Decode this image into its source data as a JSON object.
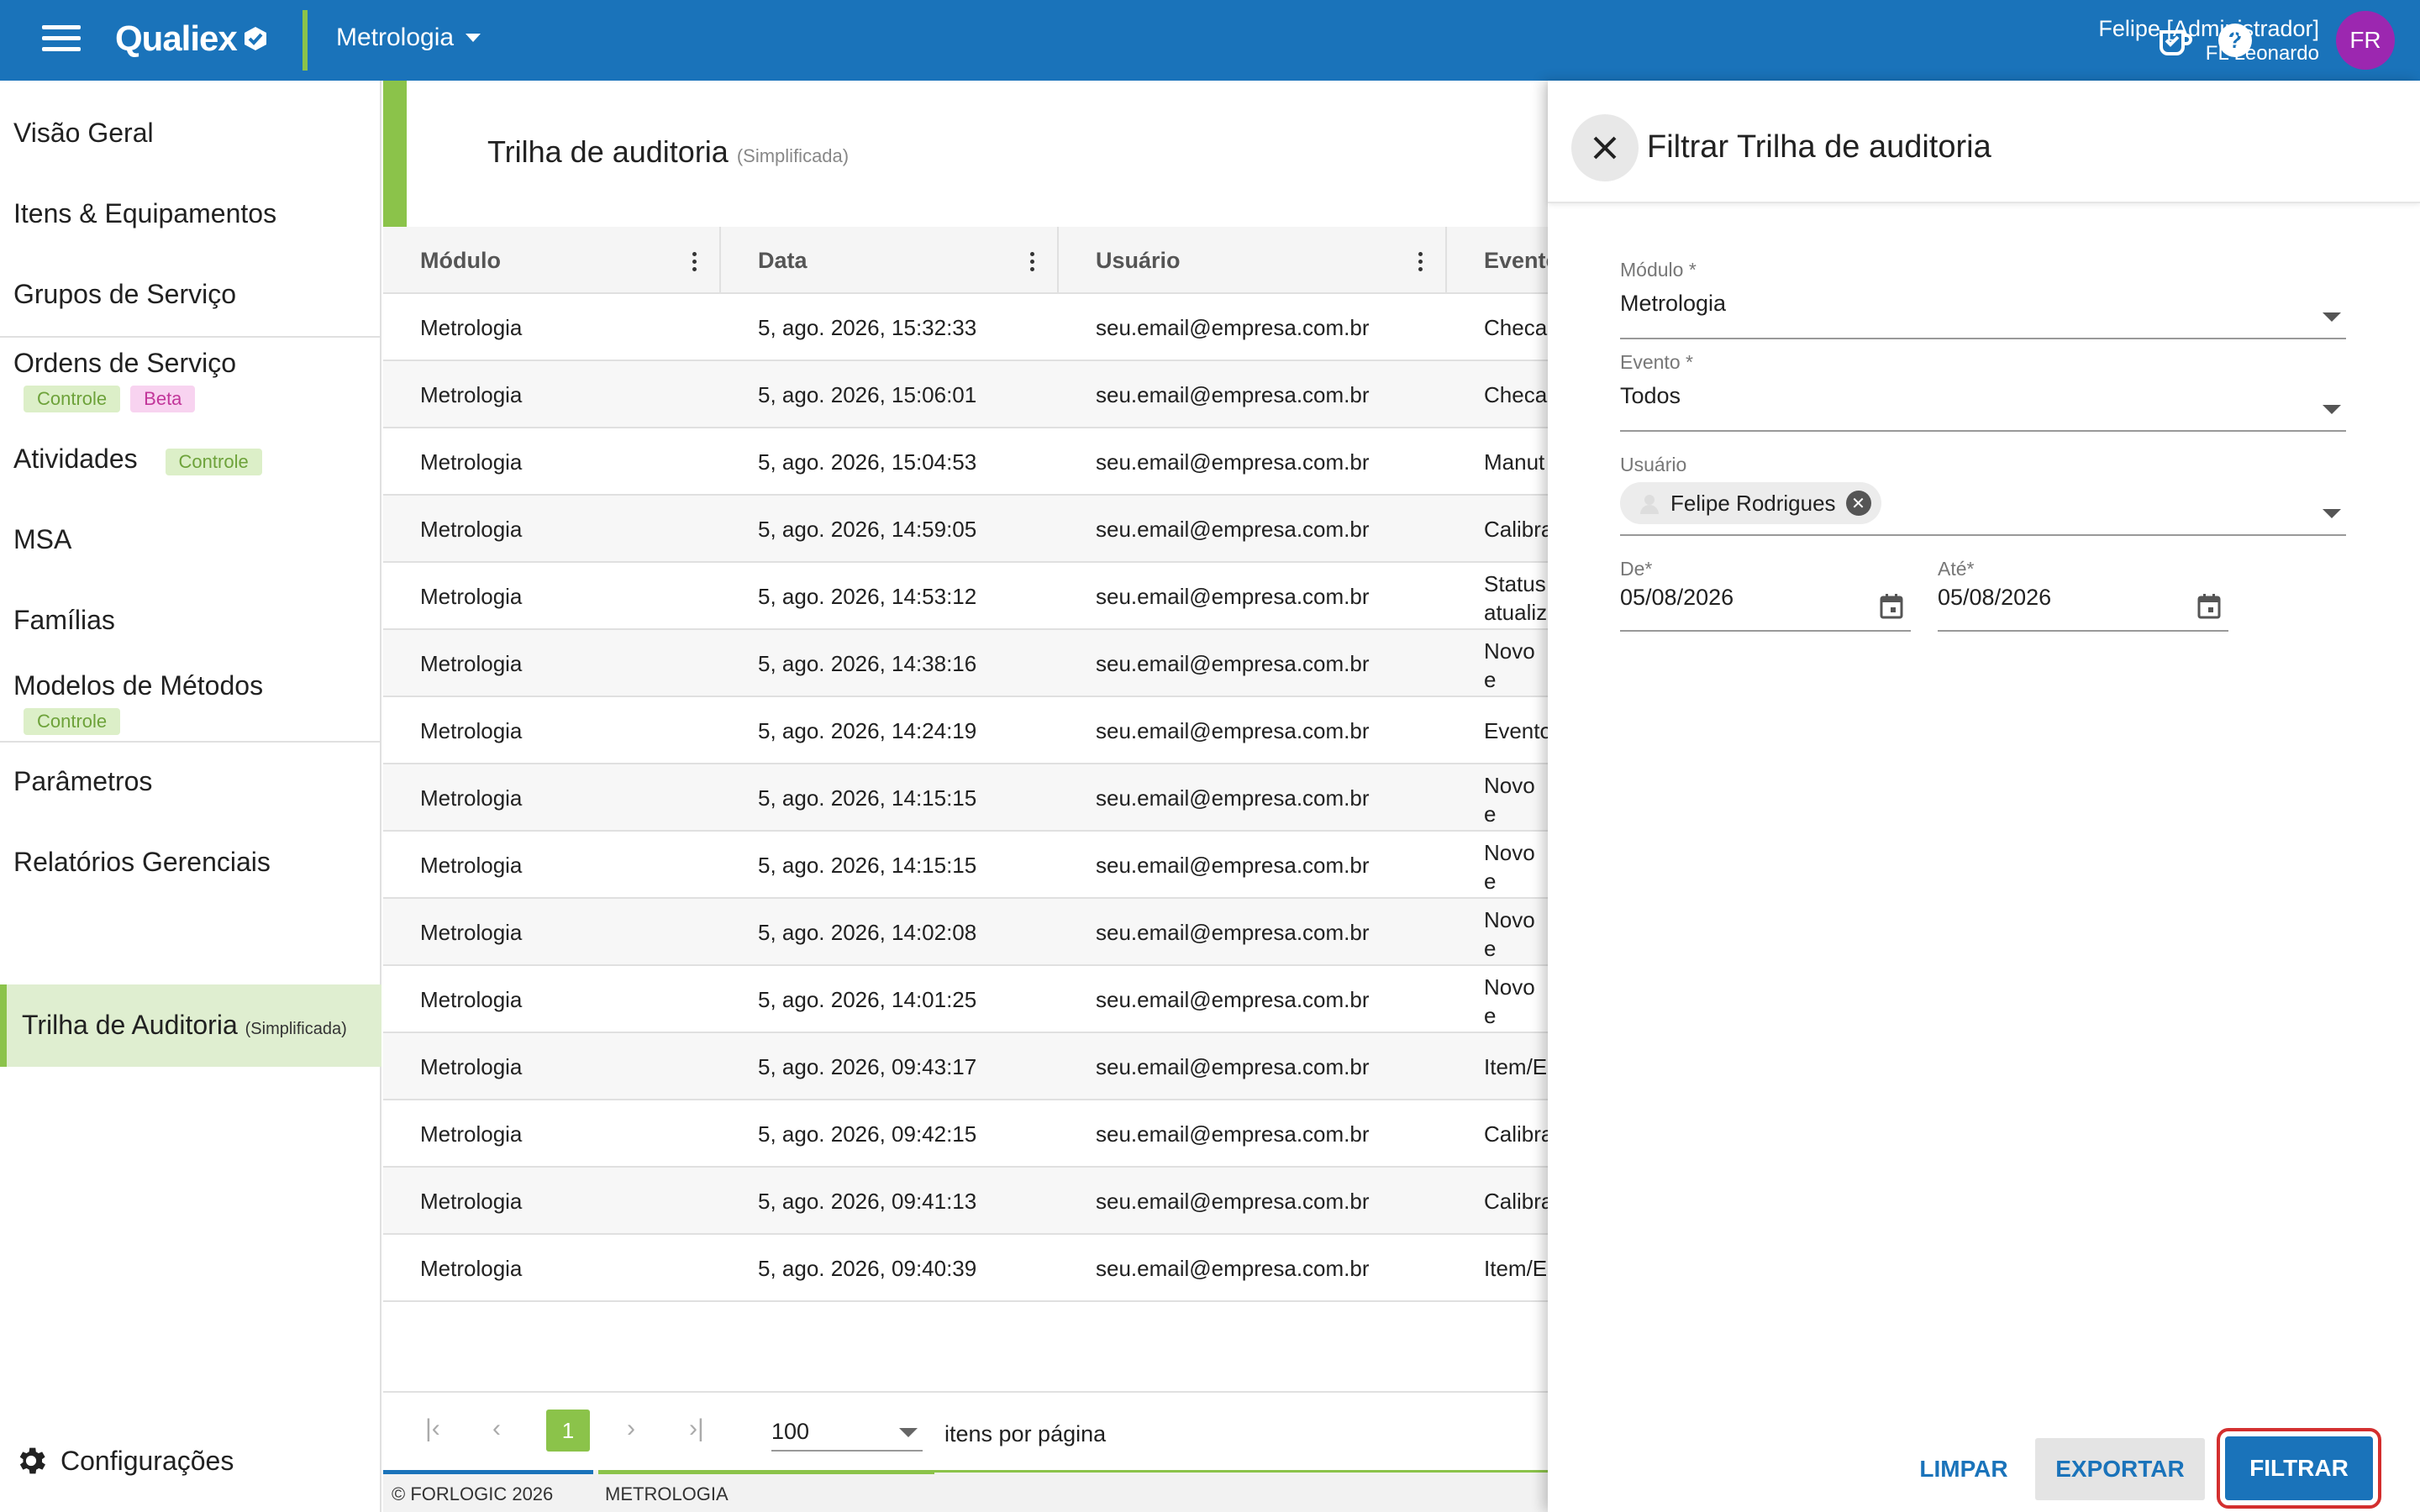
{
  "header": {
    "app_name": "Qualiex",
    "module": "Metrologia",
    "user_name": "Felipe [Administrador]",
    "user_org": "FL Leonardo",
    "avatar_initials": "FR",
    "brand_color": "#1a73ba",
    "accent_color": "#8bc34a"
  },
  "sidebar": {
    "items": [
      {
        "label": "Visão Geral"
      },
      {
        "label": "Itens & Equipamentos"
      },
      {
        "label": "Grupos de Serviço"
      },
      {
        "label": "Ordens de Serviço",
        "badges": [
          "Controle",
          "Beta"
        ]
      },
      {
        "label": "Atividades",
        "badges": [
          "Controle"
        ]
      },
      {
        "label": "MSA"
      },
      {
        "label": "Famílias"
      },
      {
        "label": "Modelos de Métodos",
        "badges": [
          "Controle"
        ]
      },
      {
        "label": "Parâmetros"
      },
      {
        "label": "Relatórios Gerenciais"
      },
      {
        "label": "Trilha de Auditoria",
        "suffix": "(Simplificada)"
      }
    ],
    "settings_label": "Configurações"
  },
  "main": {
    "title": "Trilha de auditoria",
    "title_suffix": "(Simplificada)",
    "columns": [
      "Módulo",
      "Data",
      "Usuário",
      "Evento"
    ],
    "rows": [
      {
        "modulo": "Metrologia",
        "data": "5, ago. 2026, 15:32:33",
        "usuario": "seu.email@empresa.com.br",
        "evento": "Checag"
      },
      {
        "modulo": "Metrologia",
        "data": "5, ago. 2026, 15:06:01",
        "usuario": "seu.email@empresa.com.br",
        "evento": "Checag"
      },
      {
        "modulo": "Metrologia",
        "data": "5, ago. 2026, 15:04:53",
        "usuario": "seu.email@empresa.com.br",
        "evento": "Manut"
      },
      {
        "modulo": "Metrologia",
        "data": "5, ago. 2026, 14:59:05",
        "usuario": "seu.email@empresa.com.br",
        "evento": "Calibra"
      },
      {
        "modulo": "Metrologia",
        "data": "5, ago. 2026, 14:53:12",
        "usuario": "seu.email@empresa.com.br",
        "evento": "Status atualiz"
      },
      {
        "modulo": "Metrologia",
        "data": "5, ago. 2026, 14:38:16",
        "usuario": "seu.email@empresa.com.br",
        "evento": "Novo e"
      },
      {
        "modulo": "Metrologia",
        "data": "5, ago. 2026, 14:24:19",
        "usuario": "seu.email@empresa.com.br",
        "evento": "Evento"
      },
      {
        "modulo": "Metrologia",
        "data": "5, ago. 2026, 14:15:15",
        "usuario": "seu.email@empresa.com.br",
        "evento": "Novo e"
      },
      {
        "modulo": "Metrologia",
        "data": "5, ago. 2026, 14:15:15",
        "usuario": "seu.email@empresa.com.br",
        "evento": "Novo e"
      },
      {
        "modulo": "Metrologia",
        "data": "5, ago. 2026, 14:02:08",
        "usuario": "seu.email@empresa.com.br",
        "evento": "Novo e"
      },
      {
        "modulo": "Metrologia",
        "data": "5, ago. 2026, 14:01:25",
        "usuario": "seu.email@empresa.com.br",
        "evento": "Novo e"
      },
      {
        "modulo": "Metrologia",
        "data": "5, ago. 2026, 09:43:17",
        "usuario": "seu.email@empresa.com.br",
        "evento": "Item/E"
      },
      {
        "modulo": "Metrologia",
        "data": "5, ago. 2026, 09:42:15",
        "usuario": "seu.email@empresa.com.br",
        "evento": "Calibra"
      },
      {
        "modulo": "Metrologia",
        "data": "5, ago. 2026, 09:41:13",
        "usuario": "seu.email@empresa.com.br",
        "evento": "Calibra"
      },
      {
        "modulo": "Metrologia",
        "data": "5, ago. 2026, 09:40:39",
        "usuario": "seu.email@empresa.com.br",
        "evento": "Item/E"
      }
    ],
    "pager": {
      "first": "|‹",
      "prev": "‹",
      "current_page": "1",
      "next": "›",
      "last": "›|",
      "per_page": "100",
      "per_page_label": "itens por página"
    },
    "footer": {
      "copyright": "© FORLOGIC 2026",
      "module": "METROLOGIA"
    }
  },
  "filter_panel": {
    "title": "Filtrar Trilha de auditoria",
    "modulo_label": "Módulo *",
    "modulo_value": "Metrologia",
    "evento_label": "Evento *",
    "evento_value": "Todos",
    "usuario_label": "Usuário",
    "usuario_chip": "Felipe Rodrigues",
    "de_label": "De*",
    "de_value": "05/08/2026",
    "ate_label": "Até*",
    "ate_value": "05/08/2026",
    "btn_limpar": "LIMPAR",
    "btn_exportar": "EXPORTAR",
    "btn_filtrar": "FILTRAR"
  }
}
